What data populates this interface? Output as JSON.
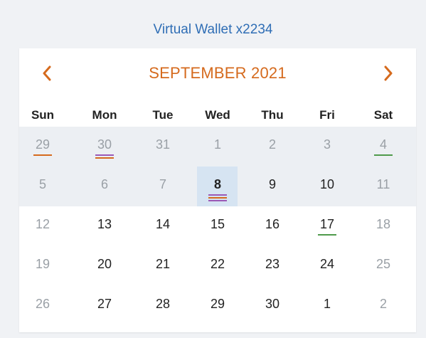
{
  "header": {
    "title": "Virtual Wallet x2234"
  },
  "calendar": {
    "month_title": "SEPTEMBER 2021",
    "prev_icon": "chevron-left-icon",
    "next_icon": "chevron-right-icon",
    "accent_color": "#d56a1d",
    "weekdays": [
      "Sun",
      "Mon",
      "Tue",
      "Wed",
      "Thu",
      "Fri",
      "Sat"
    ],
    "today": "8",
    "mark_colors": {
      "orange": "#d56a1d",
      "purple": "#9b59b6",
      "green": "#4f9a4b"
    },
    "weeks": [
      [
        {
          "label": "29",
          "muted": true,
          "marks": [
            "orange"
          ]
        },
        {
          "label": "30",
          "muted": true,
          "marks": [
            "purple",
            "orange"
          ]
        },
        {
          "label": "31",
          "muted": true,
          "marks": []
        },
        {
          "label": "1",
          "muted": true,
          "marks": []
        },
        {
          "label": "2",
          "muted": true,
          "marks": []
        },
        {
          "label": "3",
          "muted": true,
          "marks": []
        },
        {
          "label": "4",
          "muted": true,
          "marks": [
            "green"
          ]
        }
      ],
      [
        {
          "label": "5",
          "muted": true,
          "marks": []
        },
        {
          "label": "6",
          "muted": true,
          "marks": []
        },
        {
          "label": "7",
          "muted": true,
          "marks": []
        },
        {
          "label": "8",
          "muted": false,
          "today": true,
          "marks": [
            "purple",
            "orange",
            "purple"
          ]
        },
        {
          "label": "9",
          "muted": false,
          "marks": []
        },
        {
          "label": "10",
          "muted": false,
          "marks": []
        },
        {
          "label": "11",
          "muted": true,
          "marks": []
        }
      ],
      [
        {
          "label": "12",
          "muted": true,
          "marks": []
        },
        {
          "label": "13",
          "muted": false,
          "marks": []
        },
        {
          "label": "14",
          "muted": false,
          "marks": []
        },
        {
          "label": "15",
          "muted": false,
          "marks": []
        },
        {
          "label": "16",
          "muted": false,
          "marks": []
        },
        {
          "label": "17",
          "muted": false,
          "marks": [
            "green"
          ]
        },
        {
          "label": "18",
          "muted": true,
          "marks": []
        }
      ],
      [
        {
          "label": "19",
          "muted": true,
          "marks": []
        },
        {
          "label": "20",
          "muted": false,
          "marks": []
        },
        {
          "label": "21",
          "muted": false,
          "marks": []
        },
        {
          "label": "22",
          "muted": false,
          "marks": []
        },
        {
          "label": "23",
          "muted": false,
          "marks": []
        },
        {
          "label": "24",
          "muted": false,
          "marks": []
        },
        {
          "label": "25",
          "muted": true,
          "marks": []
        }
      ],
      [
        {
          "label": "26",
          "muted": true,
          "marks": []
        },
        {
          "label": "27",
          "muted": false,
          "marks": []
        },
        {
          "label": "28",
          "muted": false,
          "marks": []
        },
        {
          "label": "29",
          "muted": false,
          "marks": []
        },
        {
          "label": "30",
          "muted": false,
          "marks": []
        },
        {
          "label": "1",
          "muted": false,
          "marks": []
        },
        {
          "label": "2",
          "muted": true,
          "marks": []
        }
      ]
    ]
  }
}
